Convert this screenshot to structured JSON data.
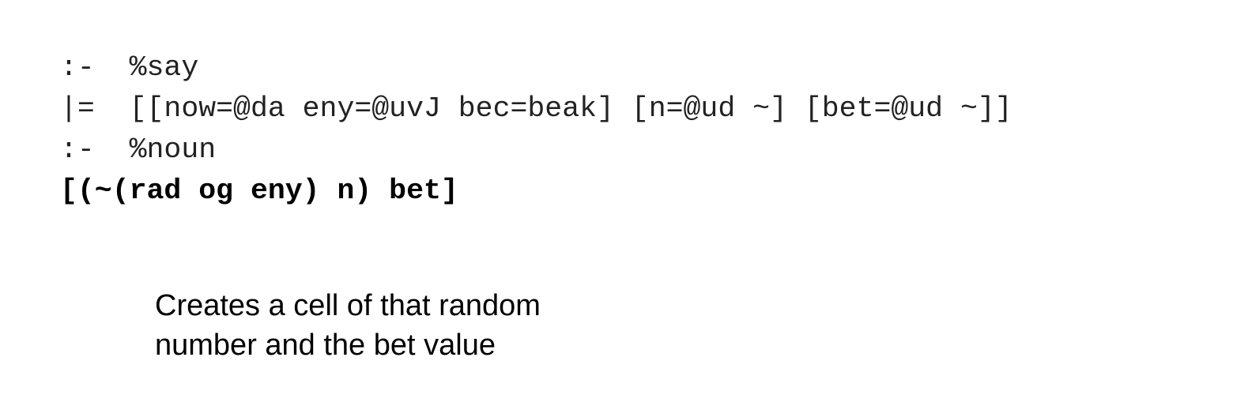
{
  "code": {
    "lines": [
      {
        "text": ":-  %say",
        "weight": "normal"
      },
      {
        "text": "|=  [[now=@da eny=@uvJ bec=beak] [n=@ud ~] [bet=@ud ~]]",
        "weight": "normal"
      },
      {
        "text": ":-  %noun",
        "weight": "normal"
      },
      {
        "text": "[(~(rad og eny) n) bet]",
        "weight": "bold"
      }
    ]
  },
  "caption": {
    "lines": [
      "Creates a cell of that random",
      "number and the bet value"
    ]
  }
}
